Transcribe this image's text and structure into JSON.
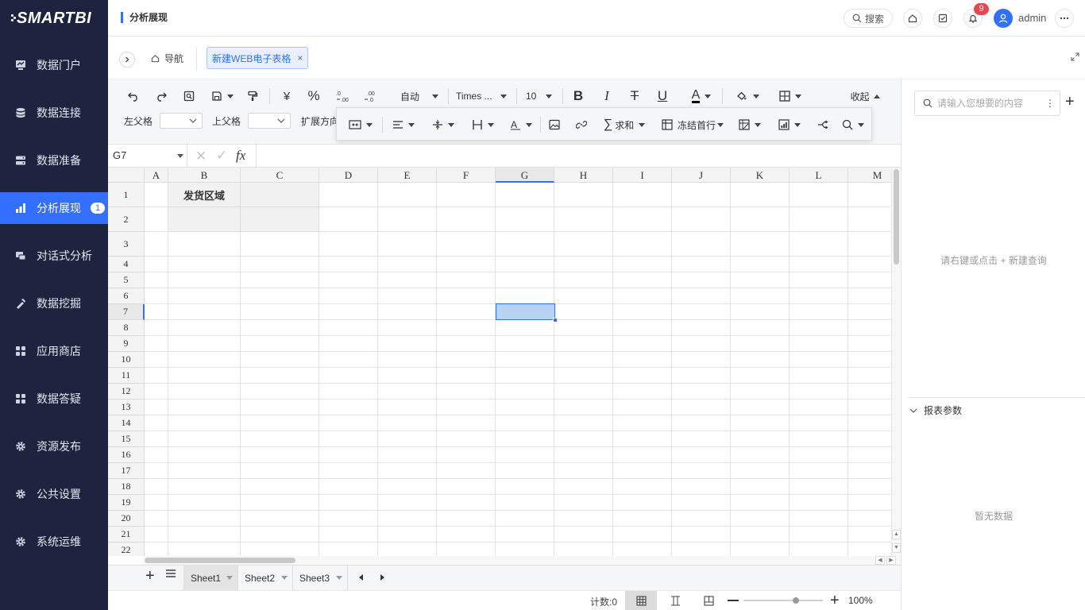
{
  "brand": "SMARTBI",
  "sidebar": {
    "items": [
      {
        "label": "数据门户",
        "icon": "monitor-icon"
      },
      {
        "label": "数据连接",
        "icon": "database-icon"
      },
      {
        "label": "数据准备",
        "icon": "server-icon"
      },
      {
        "label": "分析展现",
        "icon": "bar-chart-icon",
        "badge": "1",
        "active": true
      },
      {
        "label": "对话式分析",
        "icon": "chat-icon"
      },
      {
        "label": "数据挖掘",
        "icon": "pick-icon"
      },
      {
        "label": "应用商店",
        "icon": "apps-icon"
      },
      {
        "label": "数据答疑",
        "icon": "apps-icon"
      },
      {
        "label": "资源发布",
        "icon": "gear-icon"
      },
      {
        "label": "公共设置",
        "icon": "gear-icon"
      },
      {
        "label": "系统运维",
        "icon": "gear-icon"
      }
    ]
  },
  "header": {
    "title": "分析展现",
    "search_label": "搜索",
    "notification_count": "9",
    "user": "admin"
  },
  "tabs": {
    "home_label": "导航",
    "active_tab": "新建WEB电子表格"
  },
  "toolbar": {
    "currency": "¥",
    "percent": "%",
    "auto_label": "自动",
    "font_name": "Times ...",
    "font_size": "10",
    "collapse_label": "收起",
    "left_parent_label": "左父格",
    "top_parent_label": "上父格",
    "expand_dir_label": "扩展方向",
    "sum_label": "求和",
    "freeze_label": "冻结首行"
  },
  "formula": {
    "cell_ref": "G7",
    "fx": "fx"
  },
  "grid": {
    "columns": [
      "A",
      "B",
      "C",
      "D",
      "E",
      "F",
      "G",
      "H",
      "I",
      "J",
      "K",
      "L",
      "M"
    ],
    "rows": [
      "1",
      "2",
      "3",
      "4",
      "5",
      "6",
      "7",
      "8",
      "9",
      "10",
      "11",
      "12",
      "13",
      "14",
      "15",
      "16",
      "17",
      "18",
      "19",
      "20",
      "21",
      "22"
    ],
    "header_cell_text": "发货区域",
    "selected_column": "G",
    "selected_row": "7"
  },
  "sheets": {
    "tabs": [
      "Sheet1",
      "Sheet2",
      "Sheet3"
    ],
    "active": "Sheet1"
  },
  "status": {
    "count_label": "计数:0",
    "zoom": "100%",
    "zoom_fraction": 0.66
  },
  "right_panel": {
    "search_placeholder": "请输入您想要的内容",
    "empty_hint": "请右键或点击 + 新建查询",
    "params_label": "报表参数",
    "no_data": "暂无数据"
  },
  "colors": {
    "sidebar_bg": "#1e2440",
    "accent": "#3370ff",
    "selection_fill": "#b9d3f5",
    "header_cell_fill": "#f1f1f1",
    "badge_red": "#e5484d"
  }
}
